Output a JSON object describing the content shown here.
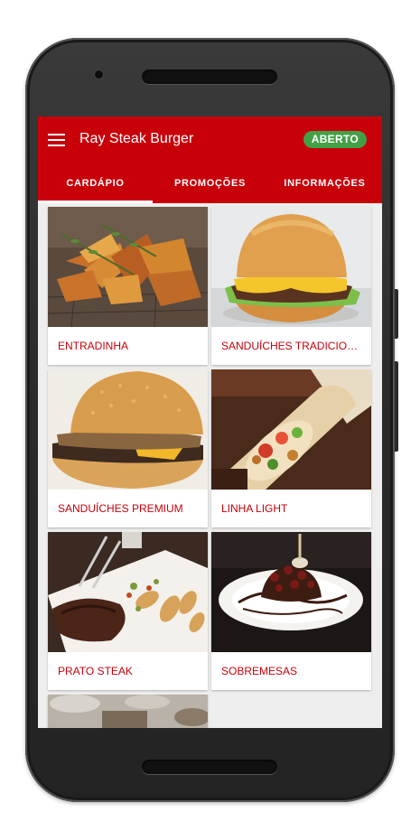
{
  "app": {
    "title": "Ray Steak Burger",
    "status": "ABERTO"
  },
  "tabs": [
    {
      "label": "CARDÁPIO",
      "active": true
    },
    {
      "label": "PROMOÇÕES",
      "active": false
    },
    {
      "label": "INFORMAÇÕES",
      "active": false
    }
  ],
  "categories": [
    {
      "label": "ENTRADINHA",
      "image": "potato-wedges"
    },
    {
      "label": "SANDUÍCHES TRADICIONAIS",
      "image": "classic-burger"
    },
    {
      "label": "SANDUÍCHES PREMIUM",
      "image": "premium-burger"
    },
    {
      "label": "LINHA LIGHT",
      "image": "wrap"
    },
    {
      "label": "PRATO STEAK",
      "image": "steak-plate"
    },
    {
      "label": "SOBREMESAS",
      "image": "dessert"
    }
  ],
  "colors": {
    "brand": "#c8000a",
    "status": "#43a047",
    "background": "#eeeeee"
  }
}
